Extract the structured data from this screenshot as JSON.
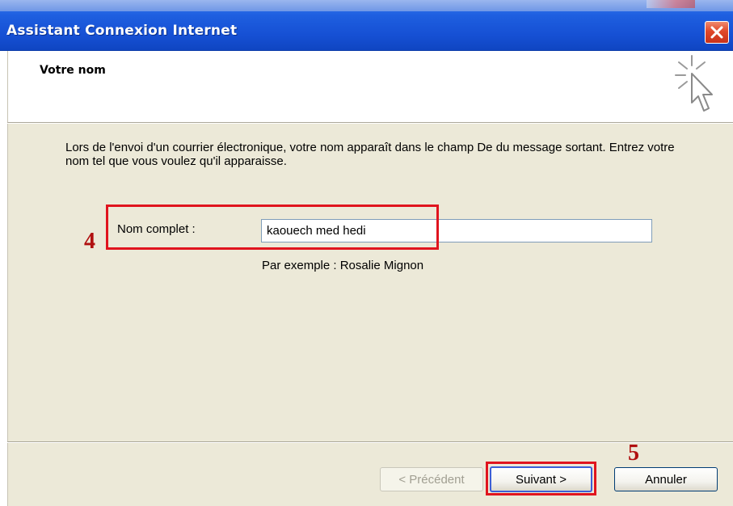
{
  "window": {
    "title": "Assistant Connexion Internet",
    "close_icon": "close-icon",
    "colors": {
      "titlebar": "#1650d4",
      "close": "#e0482a",
      "annotation": "#e0141e"
    }
  },
  "header": {
    "title": "Votre nom",
    "icon": "wizard-cursor-icon"
  },
  "body": {
    "description": "Lors de l'envoi d'un courrier électronique, votre nom apparaît dans le champ De du message sortant. Entrez votre nom tel que vous voulez qu'il apparaisse.",
    "name_label": "Nom complet :",
    "name_value": "kaouech med hedi",
    "example": "Par exemple : Rosalie Mignon"
  },
  "annotations": {
    "step4": "4",
    "step5": "5"
  },
  "buttons": {
    "previous": "< Précédent",
    "next": "Suivant >",
    "cancel": "Annuler"
  }
}
